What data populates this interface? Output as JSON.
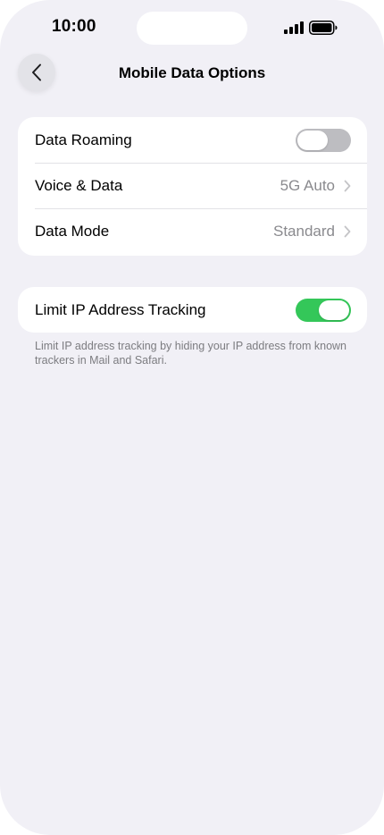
{
  "status_bar": {
    "time": "10:00",
    "signal_icon": "cellular-signal-icon",
    "battery_icon": "battery-full-icon"
  },
  "nav": {
    "back_icon": "chevron-left-icon",
    "title": "Mobile Data Options"
  },
  "group1": {
    "rows": [
      {
        "label": "Data Roaming",
        "toggle": "off"
      },
      {
        "label": "Voice & Data",
        "value": "5G Auto"
      },
      {
        "label": "Data Mode",
        "value": "Standard"
      }
    ]
  },
  "group2": {
    "rows": [
      {
        "label": "Limit IP Address Tracking",
        "toggle": "on"
      }
    ],
    "footer": "Limit IP address tracking by hiding your IP address from known trackers in Mail and Safari."
  },
  "colors": {
    "background": "#f1f0f6",
    "toggle_on": "#34c759",
    "toggle_off": "#bdbdc1",
    "secondary_text": "#8a8a8e"
  }
}
